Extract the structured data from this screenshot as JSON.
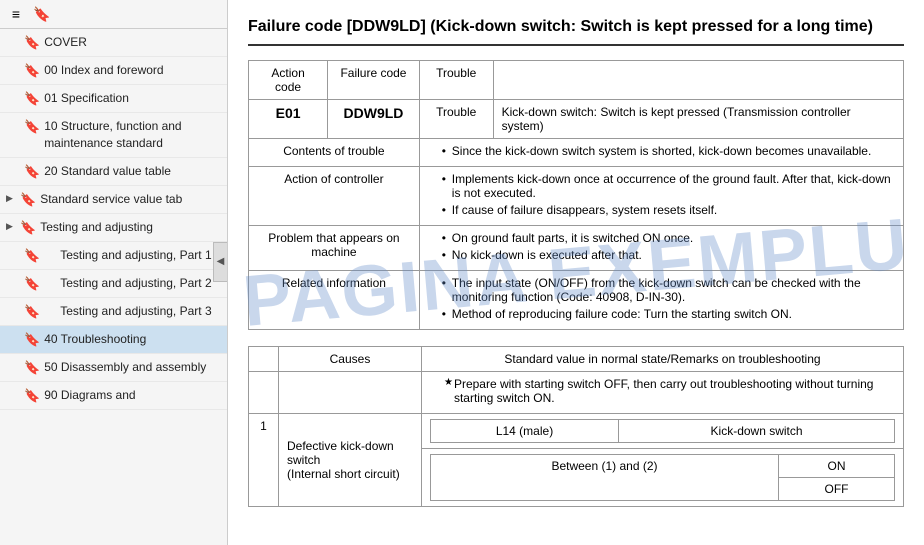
{
  "sidebar": {
    "toolbar": {
      "icon1": "≡",
      "icon2": "🔖"
    },
    "items": [
      {
        "id": "cover",
        "label": "COVER",
        "expandable": false,
        "indent": 0
      },
      {
        "id": "index",
        "label": "00 Index and foreword",
        "expandable": false,
        "indent": 0
      },
      {
        "id": "spec",
        "label": "01 Specification",
        "expandable": false,
        "indent": 0
      },
      {
        "id": "structure",
        "label": "10 Structure, function and maintenance standard",
        "expandable": false,
        "indent": 0
      },
      {
        "id": "standard",
        "label": "20 Standard value table",
        "expandable": false,
        "indent": 0
      },
      {
        "id": "service",
        "label": "Standard service value tab",
        "expandable": true,
        "indent": 0
      },
      {
        "id": "testing1",
        "label": "Testing and adjusting",
        "expandable": true,
        "indent": 0
      },
      {
        "id": "testing2",
        "label": "Testing and adjusting, Part 1",
        "expandable": false,
        "indent": 1
      },
      {
        "id": "testing3",
        "label": "Testing and adjusting, Part 2",
        "expandable": false,
        "indent": 1
      },
      {
        "id": "testing4",
        "label": "Testing and adjusting, Part 3",
        "expandable": false,
        "indent": 1
      },
      {
        "id": "troubleshooting",
        "label": "40 Troubleshooting",
        "expandable": false,
        "indent": 0,
        "active": true
      },
      {
        "id": "disassembly",
        "label": "50 Disassembly and assembly",
        "expandable": false,
        "indent": 0
      },
      {
        "id": "diagrams",
        "label": "90 Diagrams and",
        "expandable": false,
        "indent": 0
      }
    ]
  },
  "main": {
    "title": "Failure code [DDW9LD] (Kick-down switch: Switch is kept pressed for a long time)",
    "table": {
      "headers": [
        "Action code",
        "Failure code",
        "Trouble"
      ],
      "action_code": "E01",
      "failure_code": "DDW9LD",
      "trouble_text": "Kick-down switch: Switch is kept pressed (Transmission controller system)",
      "rows": [
        {
          "label": "Contents of trouble",
          "content": "Since the kick-down switch system is shorted, kick-down becomes unavailable."
        },
        {
          "label": "Action of controller",
          "content1": "Implements kick-down once at occurrence of the ground fault. After that, kick-down is not executed.",
          "content2": "If cause of failure disappears, system resets itself."
        },
        {
          "label": "Problem that appears on machine",
          "content1": "On ground fault parts, it is switched ON once.",
          "content2": "No kick-down is executed after that."
        },
        {
          "label": "Related information",
          "content1": "The input state (ON/OFF) from the kick-down switch can be checked with the monitoring function (Code: 40908, D-IN-30).",
          "content2": "Method of reproducing failure code: Turn the starting switch ON."
        }
      ]
    },
    "causes_table": {
      "header_causes": "Causes",
      "header_standard": "Standard value in normal state/Remarks on troubleshooting",
      "prepare_note": "Prepare with starting switch OFF, then carry out troubleshooting without turning starting switch ON.",
      "rows": [
        {
          "num": "1",
          "cause": "Defective kick-down switch (Internal short circuit)",
          "sub_rows": [
            {
              "label": "L14 (male)",
              "col": "Kick-down switch"
            },
            {
              "label": "Between (1) and (2)",
              "val1": "ON",
              "val2": "OFF"
            }
          ]
        }
      ]
    }
  },
  "watermark": "PAGINA EXEMPLU"
}
